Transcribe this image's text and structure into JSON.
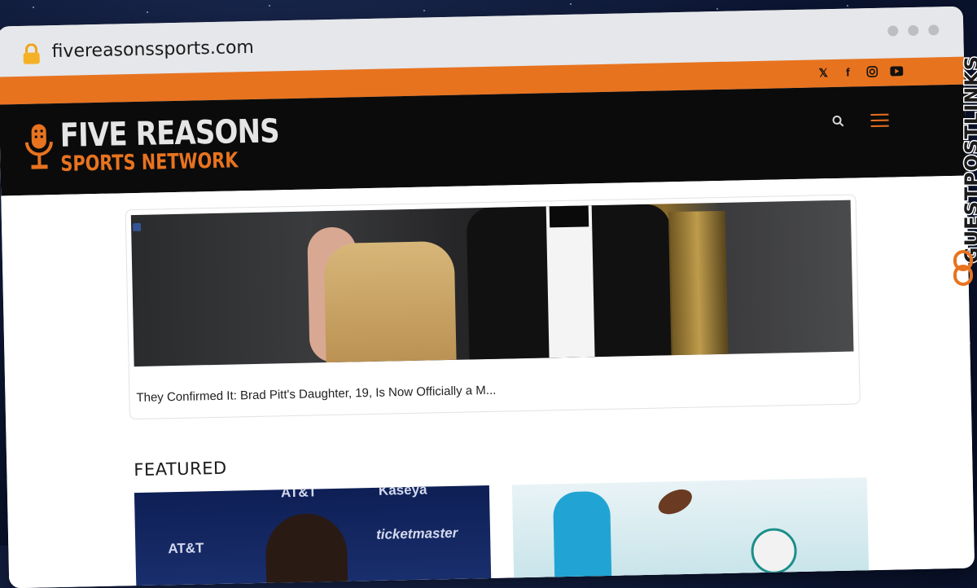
{
  "browser": {
    "url": "fivereasonssports.com"
  },
  "site": {
    "logo": {
      "line1": "FIVE REASONS",
      "line2": "SPORTS NETWORK"
    },
    "social_icons": [
      "x-icon",
      "facebook-icon",
      "instagram-icon",
      "youtube-icon"
    ],
    "header_icons": [
      "search-icon",
      "menu-icon"
    ],
    "colors": {
      "accent": "#e8731f",
      "header_bg": "#0b0b0b"
    }
  },
  "hero_card": {
    "title": "They Confirmed It: Brad Pitt's Daughter, 19, Is Now Officially a M..."
  },
  "featured": {
    "heading": "FEATURED",
    "thumb1_sponsors": [
      "AT&T",
      "AT&T",
      "ticketmaster",
      "Kaseya"
    ],
    "thumb2_sponsors": []
  },
  "watermark": {
    "text": "GUESTPOSTLINKS"
  }
}
